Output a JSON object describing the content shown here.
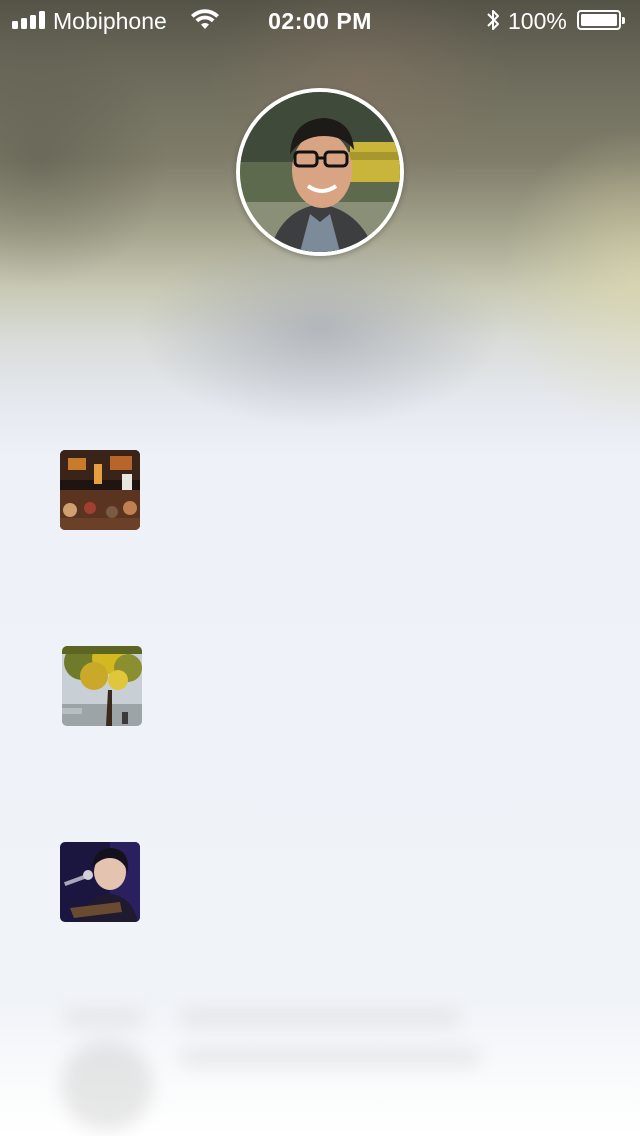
{
  "status_bar": {
    "carrier": "Mobiphone",
    "time": "02:00 PM",
    "battery_percent": "100%",
    "battery_level": 1.0,
    "signal_bars": 4,
    "icons": [
      "signal-icon",
      "wifi-icon",
      "bluetooth-icon",
      "battery-icon"
    ]
  },
  "profile": {
    "avatar_icon": "profile-photo"
  },
  "feed": {
    "items": [
      {
        "image": "night-street-photo"
      },
      {
        "image": "yellow-tree-riverside-photo"
      },
      {
        "image": "guitarist-performer-photo"
      }
    ]
  },
  "colors": {
    "status_text": "#ffffff",
    "background_light": "#eef2f8",
    "avatar_border": "#ffffff"
  }
}
